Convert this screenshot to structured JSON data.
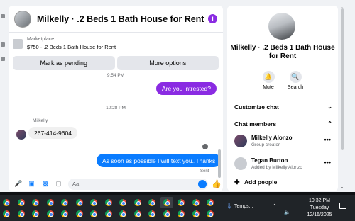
{
  "chat": {
    "title": "Milkelly · .2 Beds 1 Bath House for Rent",
    "marketplace_label": "Marketplace",
    "listing": "$750 - .2 Beds 1 Bath House for Rent",
    "mark_pending": "Mark as pending",
    "more_options": "More options",
    "time1": "9:54 PM",
    "msg_out_1": "Are you intrested?",
    "time2": "10:28 PM",
    "sender": "Milkelly",
    "msg_in_1": "267-414-9604",
    "msg_out_2": "As soon as possible I will text you..Thanks",
    "sent_label": "Sent",
    "input_placeholder": "Aa"
  },
  "info": {
    "title": "Milkelly · .2 Beds 1 Bath House for Rent",
    "mute": "Mute",
    "search": "Search",
    "customize": "Customize chat",
    "members_header": "Chat members",
    "members": [
      {
        "name": "Milkelly Alonzo",
        "sub": "Group creator"
      },
      {
        "name": "Tegan Burton",
        "sub": "Added by Milkelly Alonzo"
      }
    ],
    "add_people": "Add people"
  },
  "taskbar": {
    "weather": "Temps...",
    "time": "10:32 PM",
    "day": "Tuesday",
    "date": "12/16/2025"
  },
  "colors": {
    "accent": "#0a7cff",
    "purple": "#8a2be2",
    "taskbar": "#202428"
  }
}
